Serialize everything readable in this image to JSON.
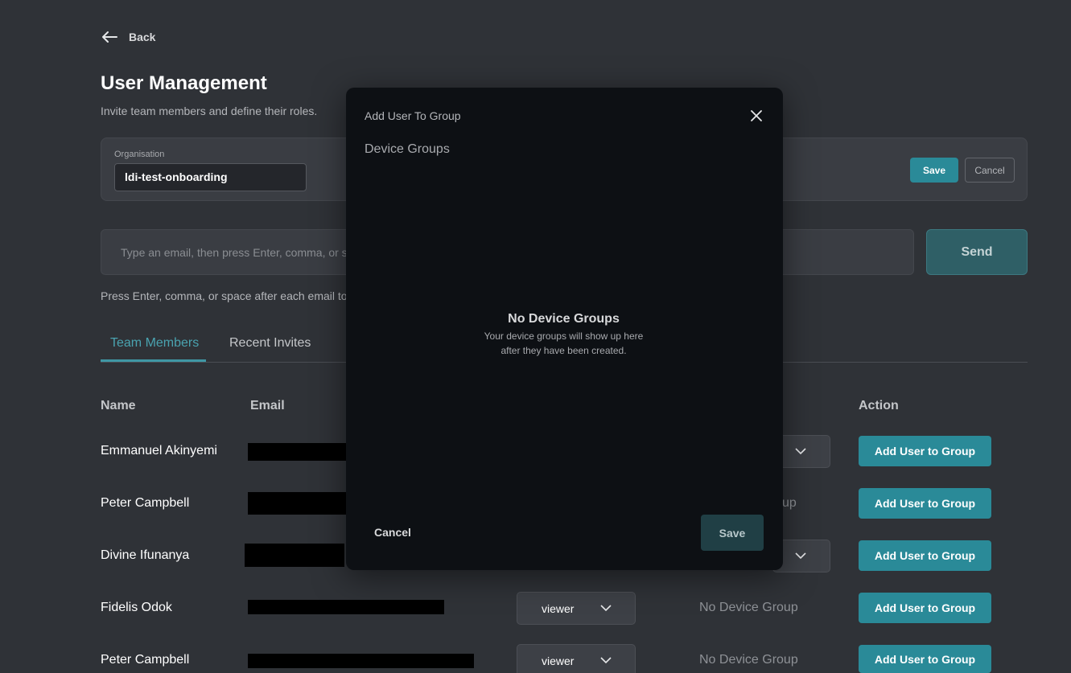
{
  "nav": {
    "back_label": "Back"
  },
  "header": {
    "title": "User Management",
    "subtitle": "Invite team members and define their roles."
  },
  "organisation": {
    "label": "Organisation",
    "value": "ldi-test-onboarding",
    "save_label": "Save",
    "cancel_label": "Cancel"
  },
  "invite": {
    "placeholder": "Type an email, then press Enter, comma, or spa",
    "send_label": "Send",
    "helper": "Press Enter, comma, or space after each email to ac"
  },
  "tabs": [
    {
      "label": "Team Members",
      "active": true
    },
    {
      "label": "Recent Invites",
      "active": false
    }
  ],
  "table": {
    "headers": {
      "name": "Name",
      "email": "Email",
      "action": "Action"
    },
    "rows": [
      {
        "name": "Emmanuel Akinyemi",
        "role": "",
        "group": "",
        "action": "Add User to Group"
      },
      {
        "name": "Peter Campbell",
        "role": "",
        "group": "up",
        "action": "Add User to Group"
      },
      {
        "name": "Divine Ifunanya",
        "role": "",
        "group": "",
        "action": "Add User to Group"
      },
      {
        "name": "Fidelis Odok",
        "role": "viewer",
        "group": "No Device Group",
        "action": "Add User to Group"
      },
      {
        "name": "Peter Campbell",
        "role": "viewer",
        "group": "No Device Group",
        "action": "Add User to Group"
      }
    ]
  },
  "modal": {
    "title": "Add User To Group",
    "section": "Device Groups",
    "empty_title": "No Device Groups",
    "empty_desc": "Your device groups will show up here after they have been created.",
    "cancel_label": "Cancel",
    "save_label": "Save"
  },
  "colors": {
    "background": "#2f3237",
    "accent": "#2a8a98",
    "modal_bg": "#0d1014"
  }
}
